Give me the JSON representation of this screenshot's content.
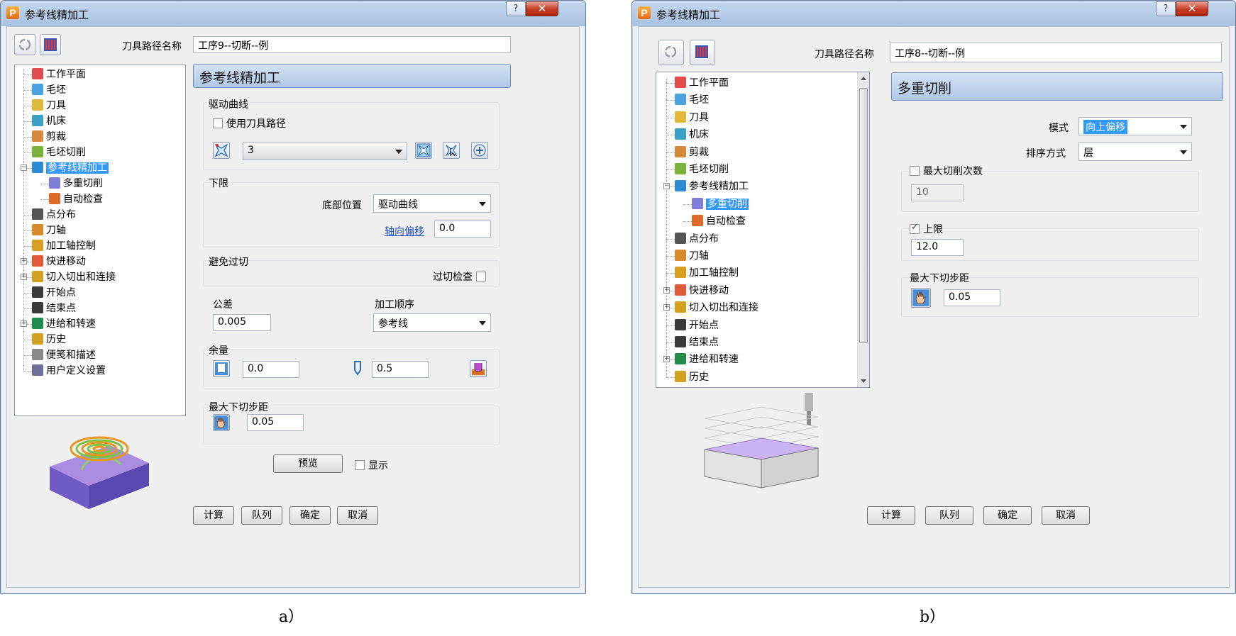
{
  "window_a": {
    "title": "参考线精加工",
    "toolpath_name_label": "刀具路径名称",
    "toolpath_name_value": "工序9--切断--例",
    "tree": [
      {
        "label": "工作平面",
        "icon": "workplane-icon"
      },
      {
        "label": "毛坯",
        "icon": "block-icon"
      },
      {
        "label": "刀具",
        "icon": "tool-icon"
      },
      {
        "label": "机床",
        "icon": "machine-icon"
      },
      {
        "label": "剪裁",
        "icon": "limit-icon"
      },
      {
        "label": "毛坯切削",
        "icon": "stock-cut-icon"
      },
      {
        "label": "参考线精加工",
        "icon": "pattern-finishing-icon",
        "selected": true
      },
      {
        "label": "多重切削",
        "icon": "multiple-cuts-icon"
      },
      {
        "label": "自动检查",
        "icon": "auto-verify-icon"
      },
      {
        "label": "点分布",
        "icon": "point-distribution-icon"
      },
      {
        "label": "刀轴",
        "icon": "tool-axis-icon"
      },
      {
        "label": "加工轴控制",
        "icon": "axis-control-icon"
      },
      {
        "label": "快进移动",
        "icon": "rapid-move-icon"
      },
      {
        "label": "切入切出和连接",
        "icon": "leads-links-icon"
      },
      {
        "label": "开始点",
        "icon": "start-point-icon"
      },
      {
        "label": "结束点",
        "icon": "end-point-icon"
      },
      {
        "label": "进给和转速",
        "icon": "feeds-speeds-icon"
      },
      {
        "label": "历史",
        "icon": "history-icon"
      },
      {
        "label": "便笺和描述",
        "icon": "notes-icon"
      },
      {
        "label": "用户定义设置",
        "icon": "user-settings-icon"
      }
    ],
    "panel_title": "参考线精加工",
    "drive_curve": {
      "title": "驱动曲线",
      "use_toolpath": "使用刀具路径",
      "combo_value": "3"
    },
    "lower_limit": {
      "title": "下限",
      "bottom_position_label": "底部位置",
      "bottom_position_value": "驱动曲线",
      "axial_offset_label": "轴向偏移",
      "axial_offset_value": "0.0"
    },
    "gouge": {
      "title": "避免过切",
      "gouge_check": "过切检查"
    },
    "tolerance_label": "公差",
    "tolerance_value": "0.005",
    "order_label": "加工顺序",
    "order_value": "参考线",
    "thickness": {
      "title": "余量",
      "radial_value": "0.0",
      "axial_value": "0.5"
    },
    "max_stepdown": {
      "title": "最大下切步距",
      "value": "0.05"
    },
    "preview_label": "预览",
    "display_label": "显示",
    "buttons": {
      "calculate": "计算",
      "queue": "队列",
      "ok": "确定",
      "cancel": "取消"
    }
  },
  "window_b": {
    "title": "参考线精加工",
    "toolpath_name_label": "刀具路径名称",
    "toolpath_name_value": "工序8--切断--例",
    "tree": [
      {
        "label": "工作平面"
      },
      {
        "label": "毛坯"
      },
      {
        "label": "刀具"
      },
      {
        "label": "机床"
      },
      {
        "label": "剪裁"
      },
      {
        "label": "毛坯切削"
      },
      {
        "label": "参考线精加工"
      },
      {
        "label": "多重切削",
        "selected": true
      },
      {
        "label": "自动检查"
      },
      {
        "label": "点分布"
      },
      {
        "label": "刀轴"
      },
      {
        "label": "加工轴控制"
      },
      {
        "label": "快进移动"
      },
      {
        "label": "切入切出和连接"
      },
      {
        "label": "开始点"
      },
      {
        "label": "结束点"
      },
      {
        "label": "进给和转速"
      },
      {
        "label": "历史"
      }
    ],
    "panel_title": "多重切削",
    "mode_label": "模式",
    "mode_value": "向上偏移",
    "sort_label": "排序方式",
    "sort_value": "层",
    "max_cuts": {
      "label": "最大切削次数",
      "value": "10"
    },
    "upper_limit": {
      "label": "上限",
      "value": "12.0"
    },
    "max_stepdown": {
      "title": "最大下切步距",
      "value": "0.05"
    },
    "buttons": {
      "calculate": "计算",
      "queue": "队列",
      "ok": "确定",
      "cancel": "取消"
    }
  },
  "captions": {
    "a": "a）",
    "b": "b）"
  },
  "colors": {
    "accent": "#3399ff",
    "panel_header": "#b0c8e6",
    "close": "#c53c21"
  }
}
